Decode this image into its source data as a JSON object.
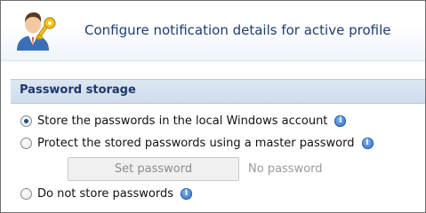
{
  "header": {
    "title": "Configure notification details for active profile",
    "icon": "user-key-icon"
  },
  "section": {
    "title": "Password storage"
  },
  "options": [
    {
      "label": "Store the passwords in the local Windows account",
      "selected": true
    },
    {
      "label": "Protect the stored passwords using a master password",
      "selected": false
    },
    {
      "label": "Do not store passwords",
      "selected": false
    }
  ],
  "master_password": {
    "button_label": "Set password",
    "status": "No password"
  },
  "colors": {
    "title_text": "#1f3d73",
    "section_band": "#d6e2f0",
    "info_icon": "#2d6cc5"
  }
}
